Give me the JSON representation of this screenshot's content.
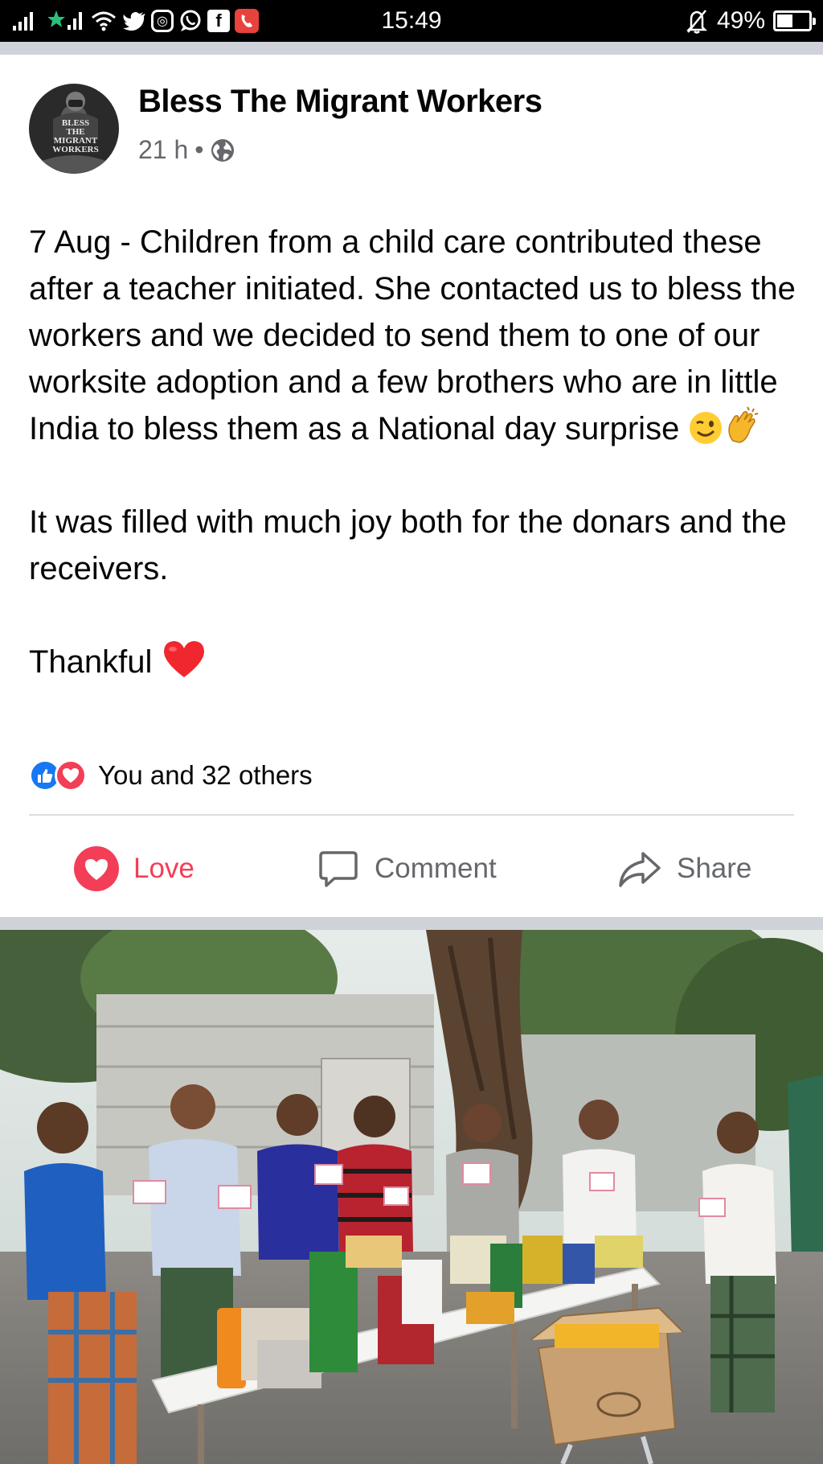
{
  "status_bar": {
    "time": "15:49",
    "battery": "49%",
    "battery_level": 0.49,
    "icons": [
      "signal-icon",
      "signal-icon",
      "wifi-icon",
      "twitter-icon",
      "instagram-icon",
      "whatsapp-icon",
      "facebook-icon",
      "phone-notification-icon",
      "bell-muted-icon",
      "battery-icon"
    ]
  },
  "post": {
    "page_name": "Bless The Migrant Workers",
    "avatar_text": "BLESS THE MIGRANT WORKERS",
    "time_ago": "21 h",
    "separator": "•",
    "audience_icon": "globe-icon",
    "paragraphs": [
      "7 Aug - Children from a child care contributed these after a teacher initiated. She contacted us to bless the workers and we decided to send them to one of our worksite adoption and a few brothers who are in little India to bless them as a National day surprise",
      "It was filled with much joy both for the donars and the receivers.",
      "Thankful"
    ],
    "emojis": {
      "p1": [
        "wink-emoji-icon",
        "clapping-hands-emoji-icon"
      ],
      "p3": [
        "red-heart-emoji-icon"
      ]
    },
    "reactions": {
      "icons": [
        "like-reaction-icon",
        "love-reaction-icon"
      ],
      "summary": "You and 32 others"
    },
    "actions": {
      "love_label": "Love",
      "comment_label": "Comment",
      "share_label": "Share"
    }
  },
  "photo": {
    "scene": "outdoor-group-photo"
  },
  "colors": {
    "status_bar": "#000000",
    "separator": "#cfd3d9",
    "love_red": "#f33e58",
    "like_blue": "#1877f2",
    "secondary_text": "#65676b"
  }
}
